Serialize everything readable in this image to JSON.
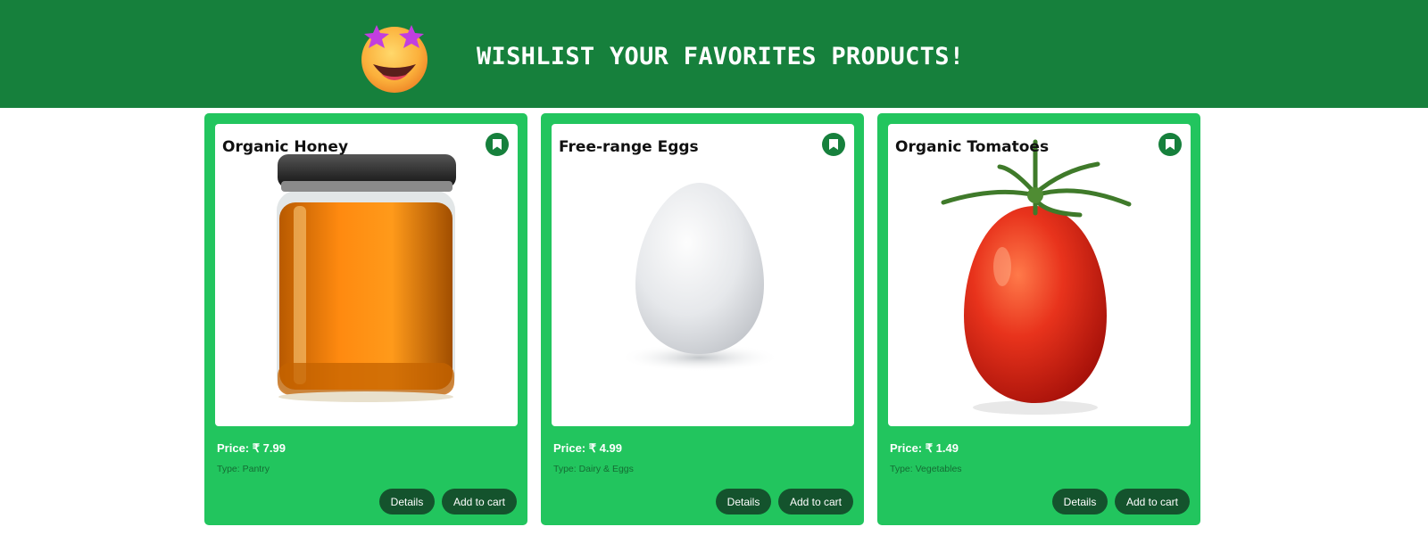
{
  "header": {
    "title": "WISHLIST YOUR FAVORITES PRODUCTS!",
    "emoji_icon": "star-struck-emoji-icon",
    "background_color": "#16803c"
  },
  "colors": {
    "card_background": "#22c55e",
    "button_background": "#14532d",
    "bookmark_background": "#16803c"
  },
  "products": [
    {
      "name": "Organic Honey",
      "price_label": "Price:",
      "price": "₹ 7.99",
      "type_label": "Type: Pantry",
      "details_label": "Details",
      "cart_label": "Add to cart",
      "image": "honey-jar"
    },
    {
      "name": "Free-range Eggs",
      "price_label": "Price:",
      "price": "₹ 4.99",
      "type_label": "Type: Dairy & Eggs",
      "details_label": "Details",
      "cart_label": "Add to cart",
      "image": "egg"
    },
    {
      "name": "Organic Tomatoes",
      "price_label": "Price:",
      "price": "₹ 1.49",
      "type_label": "Type: Vegetables",
      "details_label": "Details",
      "cart_label": "Add to cart",
      "image": "tomato"
    }
  ]
}
